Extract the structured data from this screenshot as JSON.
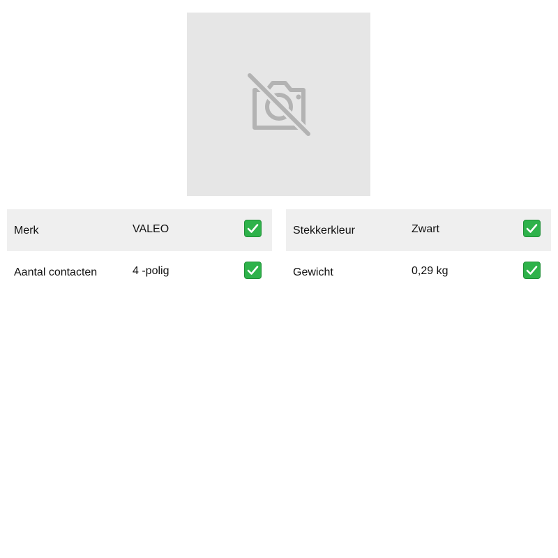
{
  "product_image": {
    "icon": "no-photo-icon"
  },
  "specs": [
    {
      "label": "Merk",
      "value": "VALEO",
      "status_icon": "check-icon"
    },
    {
      "label": "Stekkerkleur",
      "value": "Zwart",
      "status_icon": "check-icon"
    },
    {
      "label": "Aantal contacten",
      "value": "4 -polig",
      "status_icon": "check-icon"
    },
    {
      "label": "Gewicht",
      "value": "0,29 kg",
      "status_icon": "check-icon"
    }
  ],
  "colors": {
    "placeholder_bg": "#e6e6e6",
    "placeholder_icon": "#b3b3b3",
    "row_shade": "#efefef",
    "check_green": "#2eb24a"
  }
}
